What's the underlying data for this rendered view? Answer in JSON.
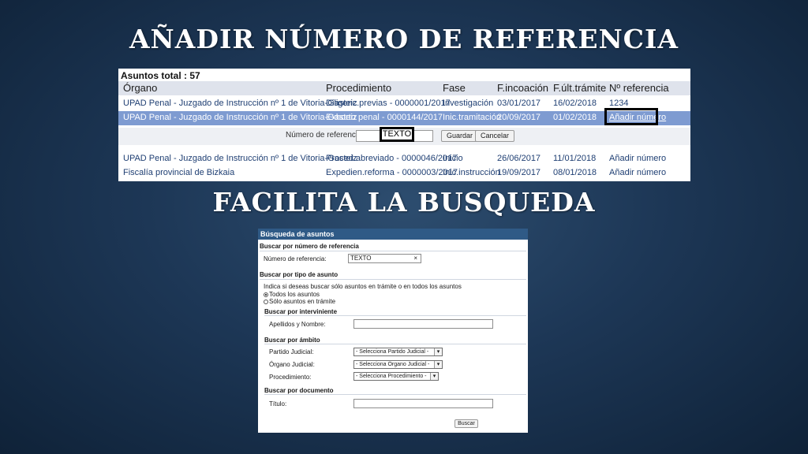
{
  "slide": {
    "title_top": "AÑADIR NÚMERO DE REFERENCIA",
    "title_middle": "FACILITA LA BUSQUEDA"
  },
  "assets_table": {
    "total_label": "Asuntos total : 57",
    "columns": [
      "Órgano",
      "Procedimiento",
      "Fase",
      "F.incoación",
      "F.últ.trámite",
      "Nº referencia"
    ],
    "rows": [
      {
        "organo": "UPAD Penal - Juzgado de Instrucción nº 1 de Vitoria-Gasteiz",
        "procedimiento": "Diligenc.previas - 0000001/2017",
        "fase": "Investigación",
        "f_incoacion": "03/01/2017",
        "f_ult_tramite": "16/02/2018",
        "referencia": "1234"
      },
      {
        "organo": "UPAD Penal - Juzgado de Instrucción nº 1 de Vitoria-Gasteiz",
        "procedimiento": "Exhorto penal - 0000144/2017",
        "fase": "Inic.tramitación",
        "f_incoacion": "20/09/2017",
        "f_ult_tramite": "01/02/2018",
        "referencia": "Añadir número"
      },
      {
        "organo": "UPAD Penal - Juzgado de Instrucción nº 1 de Vitoria-Gasteiz",
        "procedimiento": "Proced.abreviado - 0000046/2017",
        "fase": "Inicio",
        "f_incoacion": "26/06/2017",
        "f_ult_tramite": "11/01/2018",
        "referencia": "Añadir número"
      },
      {
        "organo": "Fiscalía provincial de Bizkaia",
        "procedimiento": "Expedien.reforma - 0000003/2017",
        "fase": "Inic.instrucción",
        "f_incoacion": "19/09/2017",
        "f_ult_tramite": "08/01/2018",
        "referencia": "Añadir número"
      }
    ],
    "inline_form": {
      "label": "Número de referencia",
      "value": "TEXTO",
      "save_label": "Guardar",
      "cancel_label": "Cancelar"
    }
  },
  "search_panel": {
    "header": "Búsqueda de asuntos",
    "by_reference": {
      "section": "Buscar por número de referencia",
      "label": "Número de referencia:",
      "value": "TEXTO",
      "clear": "×"
    },
    "by_type": {
      "section": "Buscar por tipo de asunto",
      "hint": "Indica si deseas buscar sólo asuntos en trámite o en todos los asuntos",
      "option_all": "Todos los asuntos",
      "option_active": "Sólo asuntos en trámite"
    },
    "by_participant": {
      "section": "Buscar por interviniente",
      "label": "Apellidos y Nombre:"
    },
    "by_scope": {
      "section": "Buscar por ámbito",
      "partido_label": "Partido Judicial:",
      "partido_value": "- Selecciona Partido Judicial -",
      "organo_label": "Órgano Judicial:",
      "organo_value": "- Selecciona Órgano Judicial -",
      "proc_label": "Procedimiento:",
      "proc_value": "- Selecciona Procedimiento -"
    },
    "by_document": {
      "section": "Buscar por documento",
      "label": "Título:"
    },
    "search_button": "Buscar"
  }
}
